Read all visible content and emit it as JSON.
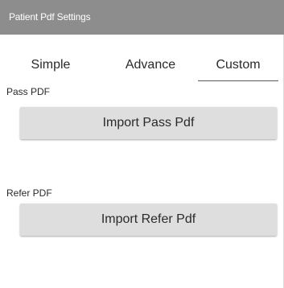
{
  "window": {
    "title": "Patient Pdf Settings"
  },
  "tabs": [
    {
      "label": "Simple",
      "active": false
    },
    {
      "label": "Advance",
      "active": false
    },
    {
      "label": "Custom",
      "active": true
    }
  ],
  "pass": {
    "section_label": "Pass PDF",
    "import_button_label": "Import Pass Pdf"
  },
  "refer": {
    "section_label": "Refer PDF",
    "import_button_label": "Import Refer Pdf"
  },
  "colors": {
    "title_bar": "#8d8d8d",
    "button_bg": "#dedede",
    "text": "#2a2a2a"
  }
}
